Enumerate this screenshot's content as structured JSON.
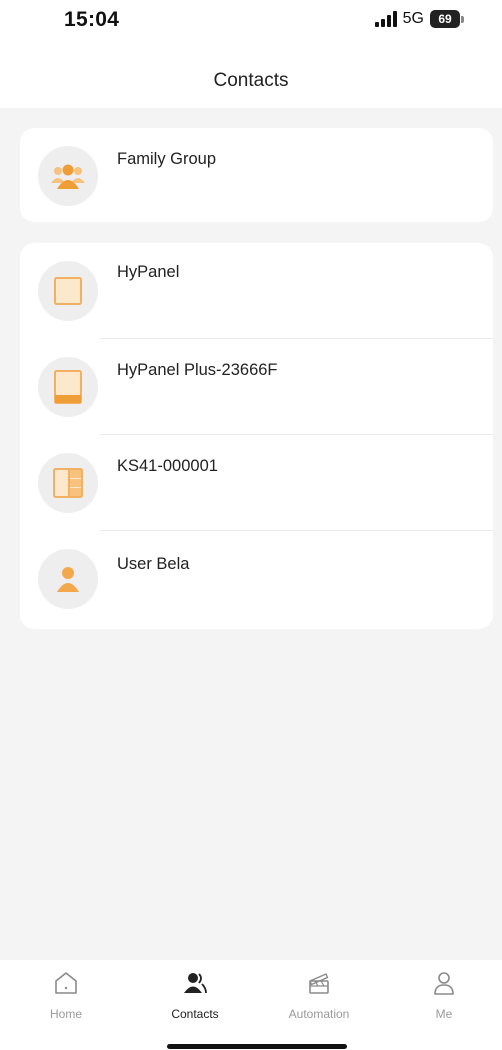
{
  "status_bar": {
    "time": "15:04",
    "network": "5G",
    "battery": "69"
  },
  "header": {
    "title": "Contacts"
  },
  "family_card": {
    "label": "Family Group",
    "icon": "family-group-icon"
  },
  "contacts": [
    {
      "label": "HyPanel",
      "icon": "panel-device-icon"
    },
    {
      "label": "HyPanel Plus-23666F",
      "icon": "panel-plus-device-icon"
    },
    {
      "label": "KS41-000001",
      "icon": "switch-device-icon"
    },
    {
      "label": "User Bela",
      "icon": "user-icon"
    }
  ],
  "bottom_nav": {
    "items": [
      {
        "label": "Home",
        "icon": "home-icon",
        "active": false
      },
      {
        "label": "Contacts",
        "icon": "contacts-icon",
        "active": true
      },
      {
        "label": "Automation",
        "icon": "automation-icon",
        "active": false
      },
      {
        "label": "Me",
        "icon": "me-icon",
        "active": false
      }
    ]
  },
  "colors": {
    "accent": "#f3a84c",
    "accent_light": "#fbe3c2",
    "background": "#f4f4f5",
    "card": "#ffffff"
  }
}
